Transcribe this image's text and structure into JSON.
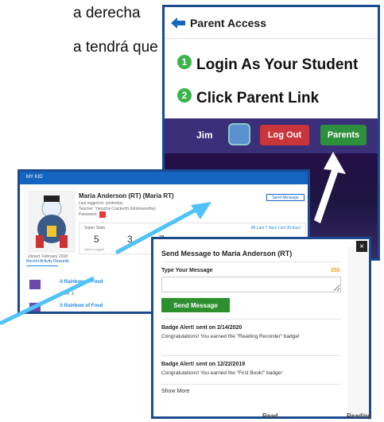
{
  "document": {
    "line1": "a derecha",
    "line2": "a tendrá que"
  },
  "parent_access": {
    "title": "Parent Access",
    "step1_num": "1",
    "step1_label": "Login As Your Student",
    "step2_num": "2",
    "step2_label": "Click Parent Link",
    "game_user": "Jim",
    "logout_label": "Log Out",
    "parents_label": "Parents"
  },
  "student_profile": {
    "topbar_label": "MY KID",
    "name": "Maria Anderson (RT) (Maria RT)",
    "last_logged": "Last logged in: yesterday",
    "teacher": "Teacher: Yanucha Crackerth (Idrisksworths)",
    "password_label": "Password:",
    "send_message_label": "Send Message",
    "super_stats_label": "Super Stats",
    "period_links": "All  Last 7 days  Last 30 days",
    "stats": [
      "5",
      "3",
      "7"
    ],
    "stats_sub": "Hours Logged",
    "joined": "Joined: February 2018",
    "tabs": "Recent Activity   Rewards",
    "activities": [
      {
        "title": "A Rainbow of Food",
        "level": "Level: 3"
      },
      {
        "title": "A Rainbow of Food",
        "level": ""
      }
    ]
  },
  "message_dialog": {
    "title": "Send Message to Maria Anderson (RT)",
    "close": "×",
    "type_label": "Type Your Message",
    "char_count": "250",
    "input_value": "",
    "send_label": "Send Message",
    "alerts": [
      {
        "title": "Badge Alert! sent on 2/14/2020",
        "body": "Congratulations! You earned the \"Reading Recorder\" badge!"
      },
      {
        "title": "Badge Alert! sent on 12/22/2019",
        "body": "Congratulations! You earned the \"First Book!\" badge!"
      }
    ],
    "show_more": "Show More",
    "bottom_left": "Read",
    "bottom_right": "Reading"
  },
  "colors": {
    "frame": "#1d4a8f",
    "green": "#2e8f2e",
    "arrow": "#4fc3f7",
    "logout": "#c8353a"
  }
}
